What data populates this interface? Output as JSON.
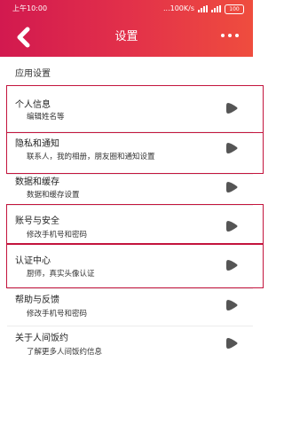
{
  "statusbar": {
    "time": "上午10:00",
    "speed": "...100K/s",
    "battery": "100"
  },
  "navbar": {
    "title": "设置"
  },
  "section": {
    "label": "应用设置"
  },
  "items": [
    {
      "title": "个人信息",
      "subtitle": "编辑姓名等"
    },
    {
      "title": "隐私和通知",
      "subtitle": "联系人，我的相册，朋友圈和通知设置"
    },
    {
      "title": "数据和缓存",
      "subtitle": "数据和缓存设置"
    },
    {
      "title": "账号与安全",
      "subtitle": "修改手机号和密码"
    },
    {
      "title": "认证中心",
      "subtitle": "厨师，真实头像认证"
    },
    {
      "title": "帮助与反馈",
      "subtitle": "修改手机号和密码"
    },
    {
      "title": "关于人间饭约",
      "subtitle": "了解更多人间饭约信息"
    }
  ],
  "colors": {
    "header_start": "#d2194f",
    "header_end": "#ef4d3e",
    "highlight_border": "#c3143d",
    "arrow": "#555555"
  },
  "icons": {
    "back": "back-arrow-icon",
    "more": "more-dots-icon",
    "item_arrow": "chevron-right-icon"
  }
}
